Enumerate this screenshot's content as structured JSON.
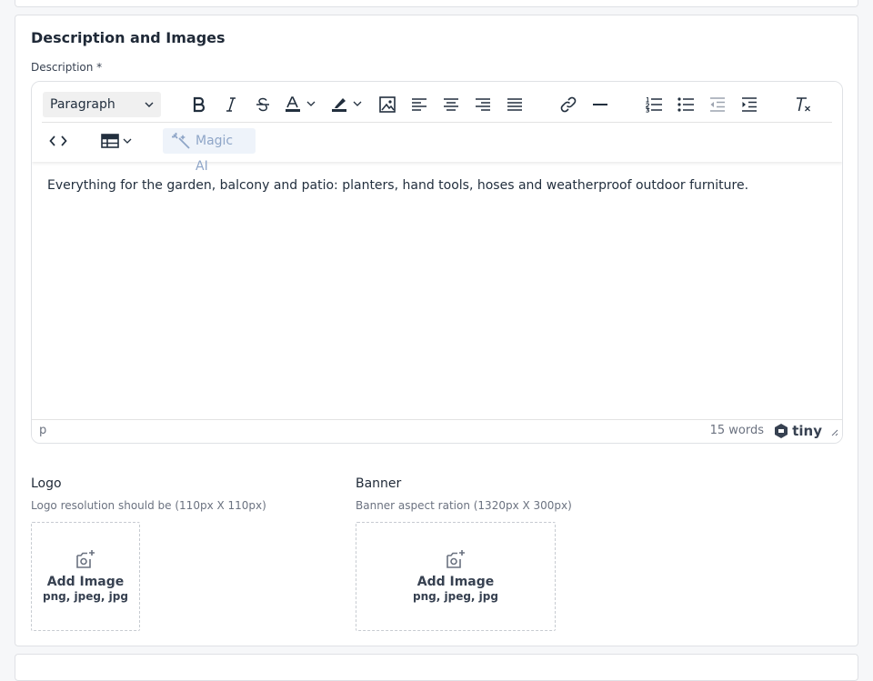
{
  "section": {
    "title": "Description and Images"
  },
  "description": {
    "label": "Description *",
    "editor": {
      "block_format": "Paragraph",
      "magic_ai_label": "Magic AI",
      "content": "Everything for the garden, balcony and patio: planters, hand tools, hoses and weatherproof outdoor furniture.",
      "status_path": "p",
      "word_count": "15 words",
      "brand": "tiny"
    }
  },
  "logo": {
    "label": "Logo",
    "hint": "Logo resolution should be (110px X 110px)",
    "add_label": "Add Image",
    "formats": "png, jpeg, jpg"
  },
  "banner": {
    "label": "Banner",
    "hint": "Banner aspect ration (1320px X 300px)",
    "add_label": "Add Image",
    "formats": "png, jpeg, jpg"
  }
}
